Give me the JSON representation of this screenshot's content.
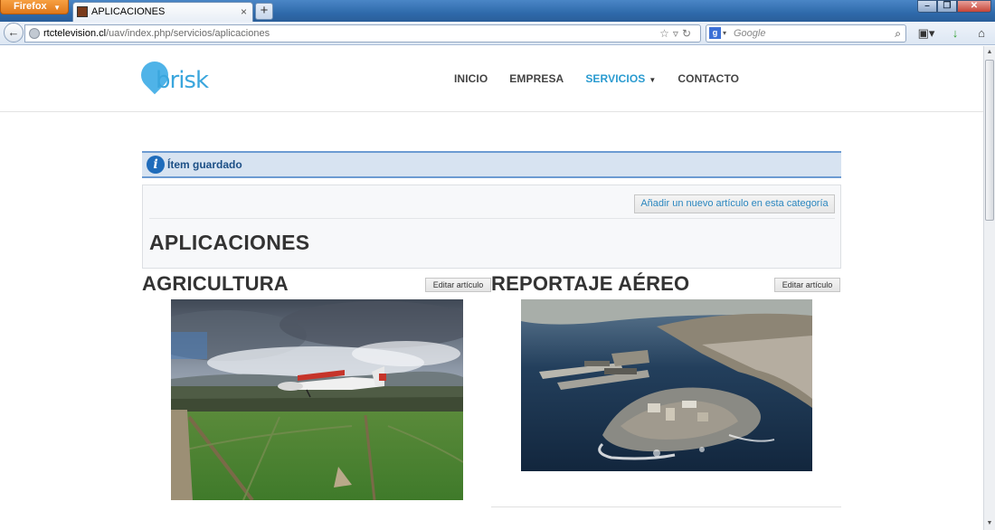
{
  "browser": {
    "app_button": "Firefox",
    "tab_title": "APLICACIONES",
    "new_tab_symbol": "+",
    "url_domain": "rtctelevision.cl",
    "url_path": "/uav/index.php/servicios/aplicaciones",
    "search_placeholder": "Google"
  },
  "site": {
    "logo_text": "brisk",
    "menu": [
      {
        "label": "INICIO"
      },
      {
        "label": "EMPRESA"
      },
      {
        "label": "SERVICIOS"
      },
      {
        "label": "CONTACTO"
      }
    ],
    "active_menu": "SERVICIOS"
  },
  "message": {
    "text": "Ítem guardado"
  },
  "category": {
    "add_button": "Añadir un nuevo artículo en esta categoría",
    "title": "APLICACIONES"
  },
  "articles": [
    {
      "title": "AGRICULTURA",
      "edit_label": "Editar artículo",
      "image_subject": "light aircraft flying low over green fields"
    },
    {
      "title": "REPORTAJE AÉREO",
      "edit_label": "Editar artículo",
      "image_subject": "aerial view of coastal port city"
    }
  ],
  "colors": {
    "accent": "#2a9bd0",
    "message_bg": "#d7e3f1",
    "message_border": "#6c9bd2",
    "logo": "#4fb3e8"
  }
}
